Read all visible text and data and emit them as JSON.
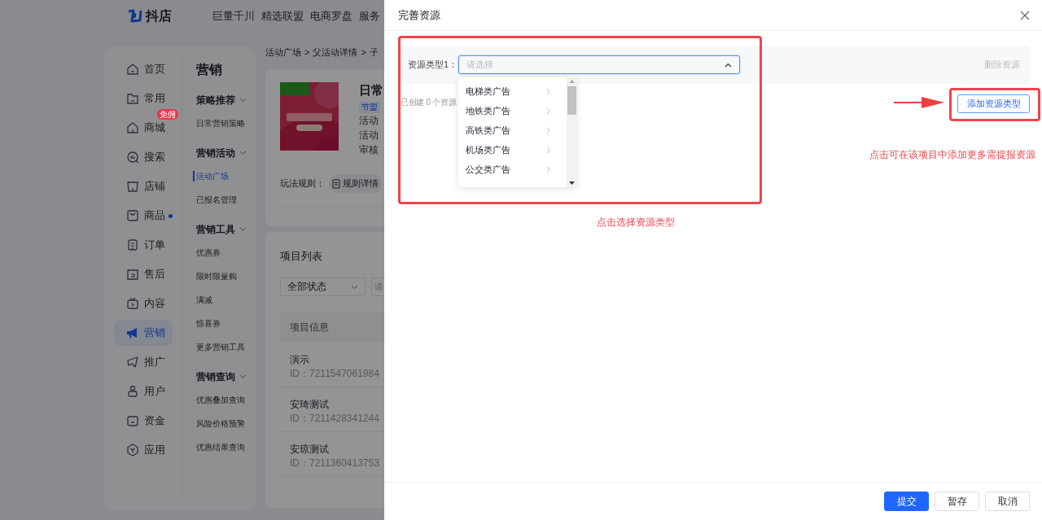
{
  "top_bar": {
    "logo": "抖店",
    "nav": [
      "巨量千川",
      "精选联盟",
      "电商罗盘",
      "服务"
    ]
  },
  "sidebar": {
    "items": [
      {
        "label": "首页",
        "selected": false
      },
      {
        "label": "常用",
        "selected": false
      },
      {
        "label": "商城",
        "selected": false,
        "badge": "免佣"
      },
      {
        "label": "搜索",
        "selected": false
      },
      {
        "label": "店铺",
        "selected": false
      },
      {
        "label": "商品",
        "selected": false,
        "dot": true
      },
      {
        "label": "订单",
        "selected": false
      },
      {
        "label": "售后",
        "selected": false
      },
      {
        "label": "内容",
        "selected": false
      },
      {
        "label": "营销",
        "selected": true
      },
      {
        "label": "推广",
        "selected": false
      },
      {
        "label": "用户",
        "selected": false
      },
      {
        "label": "资金",
        "selected": false
      },
      {
        "label": "应用",
        "selected": false
      }
    ]
  },
  "submenu": {
    "title": "营销",
    "groups": [
      {
        "title": "策略推荐",
        "expanded": true,
        "items": [
          {
            "label": "日常营销策略",
            "selected": false
          }
        ]
      },
      {
        "title": "营销活动",
        "expanded": true,
        "items": [
          {
            "label": "活动广场",
            "selected": true
          },
          {
            "label": "已报名管理",
            "selected": false
          }
        ]
      },
      {
        "title": "营销工具",
        "expanded": true,
        "items": [
          {
            "label": "优惠券",
            "selected": false
          },
          {
            "label": "限时限量购",
            "selected": false
          },
          {
            "label": "满减",
            "selected": false
          },
          {
            "label": "惊喜券",
            "selected": false
          },
          {
            "label": "更多营销工具",
            "selected": false
          }
        ]
      },
      {
        "title": "营销查询",
        "expanded": true,
        "items": [
          {
            "label": "优惠叠加查询",
            "selected": false
          },
          {
            "label": "风险价格预警",
            "selected": false
          },
          {
            "label": "优惠结果查询",
            "selected": false
          }
        ]
      }
    ]
  },
  "breadcrumb": {
    "separator": ">",
    "items": [
      "活动广场",
      "父活动详情",
      "子"
    ]
  },
  "activity": {
    "image": {
      "kind": "picture"
    },
    "title": "日常",
    "tag": "节盟",
    "lines": [
      "活动",
      "活动",
      "审核"
    ],
    "rules_label": "玩法规则：",
    "rules_button": "规则详情"
  },
  "project_list": {
    "title": "项目列表",
    "status_filter": "全部状态",
    "search": {
      "placeholder": "请"
    },
    "columns": [
      "项目信息"
    ],
    "rows": [
      {
        "name": "演示",
        "id": "ID：7211547061984"
      },
      {
        "name": "安琦测试",
        "id": "ID：7211428341244"
      },
      {
        "name": "安琼测试",
        "id": "ID：7211360413753"
      }
    ]
  },
  "drawer": {
    "title": "完善资源",
    "resources": [
      {
        "label": "资源类型1：",
        "placeholder": "请选择",
        "expanded": true,
        "delete": "删除资源"
      }
    ],
    "options": [
      {
        "label": "电梯类广告"
      },
      {
        "label": "地铁类广告"
      },
      {
        "label": "高铁类广告"
      },
      {
        "label": "机场类广告"
      },
      {
        "label": "公交类广告"
      }
    ],
    "created": "已创建 0 个资源",
    "add_button": "添加资源类型",
    "buttons": [
      {
        "label": "提交",
        "kind": "primary"
      },
      {
        "label": "暂存",
        "kind": "default"
      },
      {
        "label": "取消",
        "kind": "default"
      }
    ]
  },
  "annotations": [
    {
      "text": "点击选择资源类型"
    },
    {
      "text": "点击可在该项目中添加更多需提报资源"
    }
  ]
}
